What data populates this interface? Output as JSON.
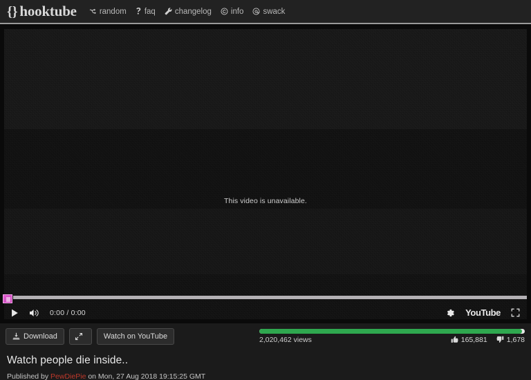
{
  "navbar": {
    "brand_braces": "{}",
    "brand_name": "hooktube",
    "links": [
      {
        "label": "random",
        "icon": "shuffle-icon"
      },
      {
        "label": "faq",
        "icon": "question-icon"
      },
      {
        "label": "changelog",
        "icon": "wrench-icon"
      },
      {
        "label": "info",
        "icon": "copyright-icon"
      },
      {
        "label": "swack",
        "icon": "at-icon"
      }
    ]
  },
  "player": {
    "message": "This video is unavailable.",
    "time_display": "0:00 / 0:00",
    "youtube_wordmark": "YouTube",
    "progress_percent": 0,
    "controls": {
      "play": "play-icon",
      "volume": "volume-icon",
      "settings": "gear-icon",
      "fullscreen": "fullscreen-icon"
    }
  },
  "actions": {
    "download_label": "Download",
    "expand_label": "",
    "watch_label": "Watch on YouTube"
  },
  "stats": {
    "views": "2,020,462 views",
    "likes": "165,881",
    "dislikes": "1,678",
    "like_ratio_percent": 99,
    "bar_color": "#2fa84f"
  },
  "video": {
    "title": "Watch people die inside..",
    "published_prefix": "Published by",
    "author": "PewDiePie",
    "published_suffix": "on Mon, 27 Aug 2018 19:15:25 GMT",
    "author_color": "#c0392b"
  }
}
